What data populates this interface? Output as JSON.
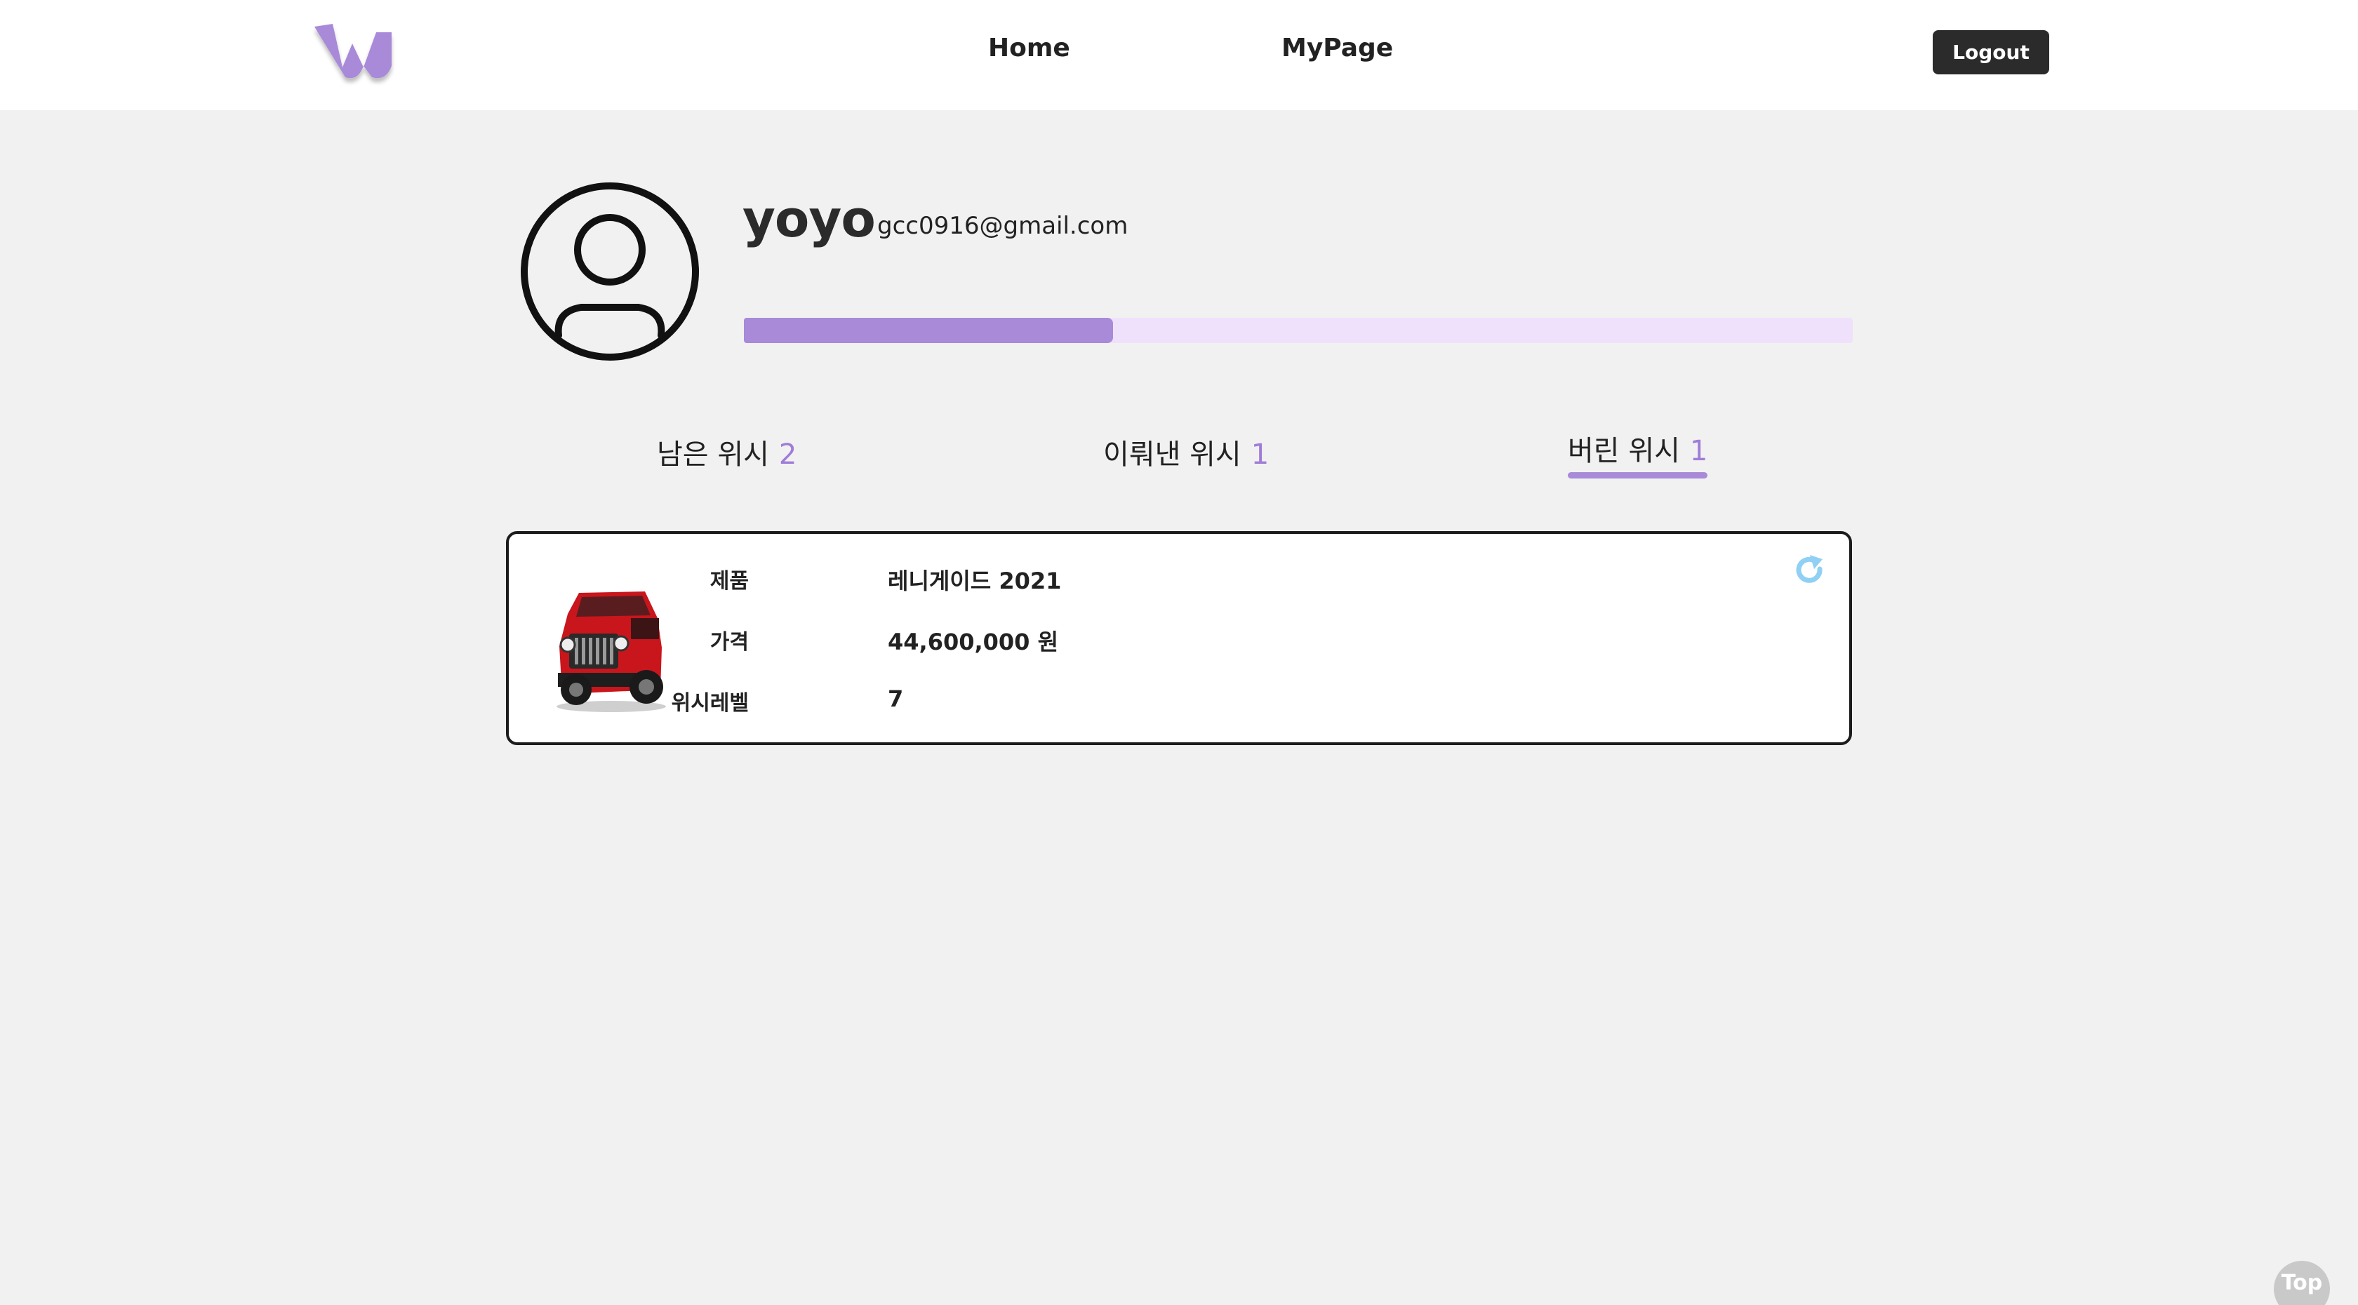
{
  "header": {
    "logo_icon": "wishlist-w-logo",
    "nav": {
      "home": "Home",
      "mypage": "MyPage"
    },
    "logout_label": "Logout"
  },
  "profile": {
    "avatar_icon": "user-circle-icon",
    "username": "yoyo",
    "email": "gcc0916@gmail.com",
    "progress_fraction": 0.333
  },
  "tabs": [
    {
      "label": "남은 위시",
      "count": "2",
      "active": false
    },
    {
      "label": "이뤄낸 위시",
      "count": "1",
      "active": false
    },
    {
      "label": "버린 위시",
      "count": "1",
      "active": true
    }
  ],
  "wish_card": {
    "image_icon": "red-jeep-renegade-image",
    "fields": [
      {
        "label": "제품",
        "value": "레니게이드 2021"
      },
      {
        "label": "가격",
        "value": "44,600,000 원"
      },
      {
        "label": "위시레벨",
        "value": "7"
      }
    ],
    "restore_icon": "restore-icon"
  },
  "top_button_label": "Top",
  "colors": {
    "accent": "#a88ad8",
    "accent_light": "#efe1fb",
    "background": "#f1f1f1",
    "restore_blue": "#8fd0f4"
  }
}
